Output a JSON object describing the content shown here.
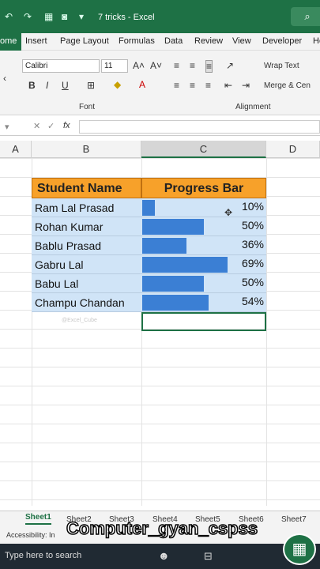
{
  "window": {
    "title": "7 tricks  -  Excel",
    "search_icon": "search-icon"
  },
  "tabs": [
    "ome",
    "Insert",
    "Page Layout",
    "Formulas",
    "Data",
    "Review",
    "View",
    "Developer",
    "He"
  ],
  "ribbon": {
    "font_name": "Calibri",
    "font_size": "11",
    "font_group_label": "Font",
    "alignment_group_label": "Alignment",
    "wrap_text": "Wrap Text",
    "merge": "Merge & Cen",
    "bold": "B",
    "italic": "I",
    "underline": "U",
    "grow": "A˄",
    "shrink": "A˅"
  },
  "formula_bar": {
    "fx": "fx"
  },
  "columns": [
    "A",
    "B",
    "C",
    "D"
  ],
  "table": {
    "header": [
      "Student Name",
      "Progress Bar"
    ],
    "rows": [
      {
        "name": "Ram Lal Prasad",
        "pct": "10%",
        "value": 0.1
      },
      {
        "name": "Rohan Kumar",
        "pct": "50%",
        "value": 0.5
      },
      {
        "name": "Bablu Prasad",
        "pct": "36%",
        "value": 0.36
      },
      {
        "name": "Gabru Lal",
        "pct": "69%",
        "value": 0.69
      },
      {
        "name": "Babu Lal",
        "pct": "50%",
        "value": 0.5
      },
      {
        "name": "Champu Chandan",
        "pct": "54%",
        "value": 0.54
      }
    ]
  },
  "watermark": "@Excel_Cube",
  "sheets": [
    "Sheet1",
    "Sheet2",
    "Sheet3",
    "Sheet4",
    "Sheet5",
    "Sheet6",
    "Sheet7"
  ],
  "status": {
    "accessibility": "Accessibility: In"
  },
  "taskbar": {
    "search": "Type here to search"
  },
  "overlay": "Computer_gyan_cspss",
  "colors": {
    "excel_green": "#1e7145",
    "header_orange": "#f7a12a",
    "bar_blue": "#3b7fd4",
    "row_blue": "#d0e4f7"
  }
}
